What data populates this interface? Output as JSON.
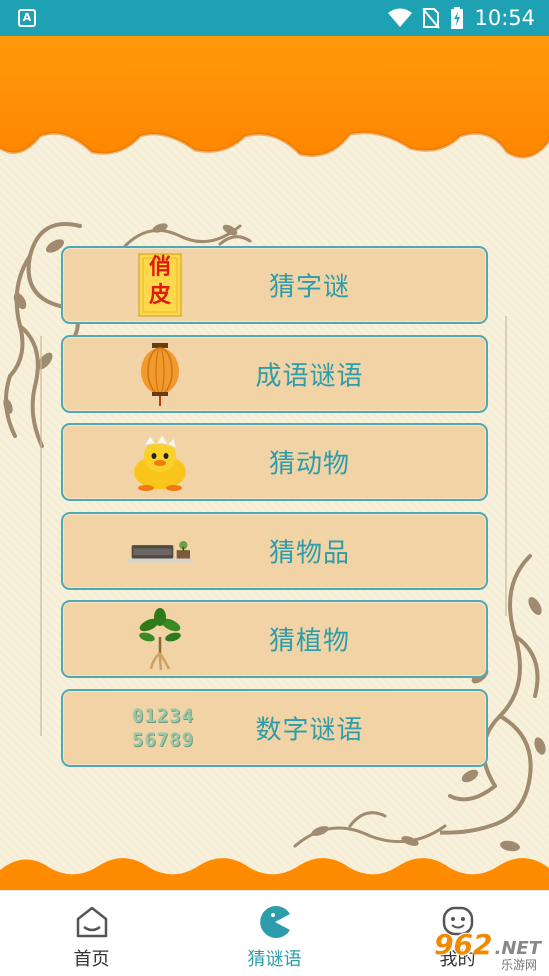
{
  "status_bar": {
    "app_badge": "A",
    "time": "10:54"
  },
  "menu": {
    "items": [
      {
        "label": "猜字谜",
        "icon": "riddle-character-icon",
        "icon_text_top": "俏",
        "icon_text_bottom": "皮"
      },
      {
        "label": "成语谜语",
        "icon": "lantern-icon"
      },
      {
        "label": "猜动物",
        "icon": "chick-icon"
      },
      {
        "label": "猜物品",
        "icon": "sofa-icon"
      },
      {
        "label": "猜植物",
        "icon": "plant-icon"
      },
      {
        "label": "数字谜语",
        "icon": "numbers-icon",
        "icon_text_top": "01234",
        "icon_text_bottom": "56789"
      }
    ]
  },
  "bottom_nav": {
    "items": [
      {
        "label": "首页",
        "icon": "home-icon",
        "active": false
      },
      {
        "label": "猜谜语",
        "icon": "pacman-icon",
        "active": true
      },
      {
        "label": "我的",
        "icon": "profile-face-icon",
        "active": false
      }
    ]
  },
  "watermark": {
    "num": "962",
    "net": ".NET",
    "sub": "乐游网"
  },
  "colors": {
    "status_bar": "#1ea2b3",
    "banner": "#ff8f00",
    "accent": "#2e9dab",
    "button_bg": "#f1d3a6"
  }
}
